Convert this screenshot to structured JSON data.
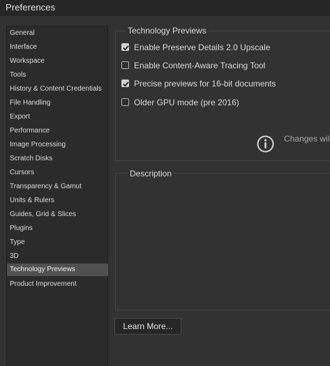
{
  "window": {
    "title": "Preferences"
  },
  "sidebar": {
    "items": [
      {
        "label": "General"
      },
      {
        "label": "Interface"
      },
      {
        "label": "Workspace"
      },
      {
        "label": "Tools"
      },
      {
        "label": "History & Content Credentials"
      },
      {
        "label": "File Handling"
      },
      {
        "label": "Export"
      },
      {
        "label": "Performance"
      },
      {
        "label": "Image Processing"
      },
      {
        "label": "Scratch Disks"
      },
      {
        "label": "Cursors"
      },
      {
        "label": "Transparency & Gamut"
      },
      {
        "label": "Units & Rulers"
      },
      {
        "label": "Guides, Grid & Slices"
      },
      {
        "label": "Plugins"
      },
      {
        "label": "Type"
      },
      {
        "label": "3D"
      },
      {
        "label": "Technology Previews",
        "selected": true
      },
      {
        "label": "Product Improvement"
      }
    ]
  },
  "tech_previews": {
    "title": "Technology Previews",
    "options": [
      {
        "label": "Enable Preserve Details 2.0 Upscale",
        "checked": true
      },
      {
        "label": "Enable Content-Aware Tracing Tool",
        "checked": false
      },
      {
        "label": "Precise previews for 16-bit documents",
        "checked": true
      },
      {
        "label": "Older GPU mode (pre 2016)",
        "checked": false
      }
    ],
    "info_icon": "info-circle-icon",
    "notice_text": "Changes wil"
  },
  "description": {
    "title": "Description"
  },
  "buttons": {
    "learn_more": "Learn More..."
  }
}
